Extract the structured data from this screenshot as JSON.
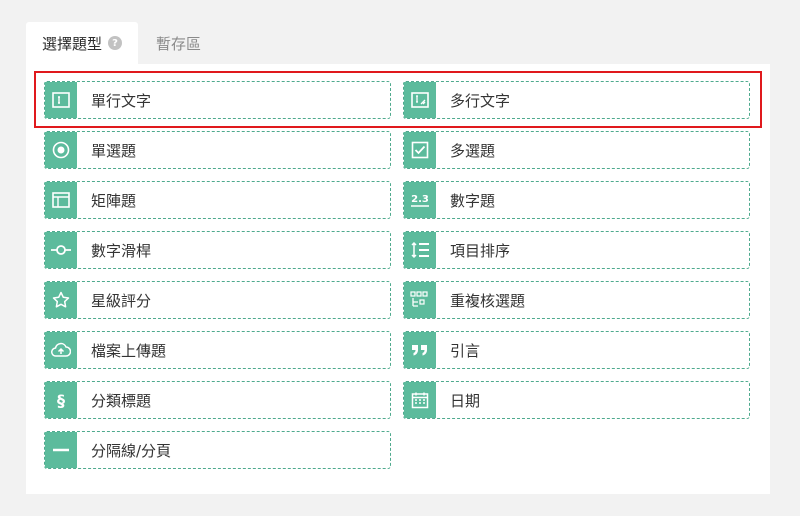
{
  "tabs": [
    {
      "label": "選擇題型",
      "active": true
    },
    {
      "label": "暫存區",
      "active": false
    }
  ],
  "question_types": [
    {
      "label": "單行文字",
      "icon": "single-line-text-icon"
    },
    {
      "label": "多行文字",
      "icon": "multi-line-text-icon"
    },
    {
      "label": "單選題",
      "icon": "radio-icon"
    },
    {
      "label": "多選題",
      "icon": "checkbox-icon"
    },
    {
      "label": "矩陣題",
      "icon": "matrix-icon"
    },
    {
      "label": "數字題",
      "icon": "number-icon"
    },
    {
      "label": "數字滑桿",
      "icon": "slider-icon"
    },
    {
      "label": "項目排序",
      "icon": "sort-icon"
    },
    {
      "label": "星級評分",
      "icon": "star-icon"
    },
    {
      "label": "重複核選題",
      "icon": "repeat-check-icon"
    },
    {
      "label": "檔案上傳題",
      "icon": "upload-icon"
    },
    {
      "label": "引言",
      "icon": "quote-icon"
    },
    {
      "label": "分類標題",
      "icon": "section-icon"
    },
    {
      "label": "日期",
      "icon": "calendar-icon"
    },
    {
      "label": "分隔線/分頁",
      "icon": "divider-icon"
    }
  ],
  "colors": {
    "accent": "#5cbb9c",
    "border": "#4faa8e",
    "highlight": "#e0191d"
  }
}
